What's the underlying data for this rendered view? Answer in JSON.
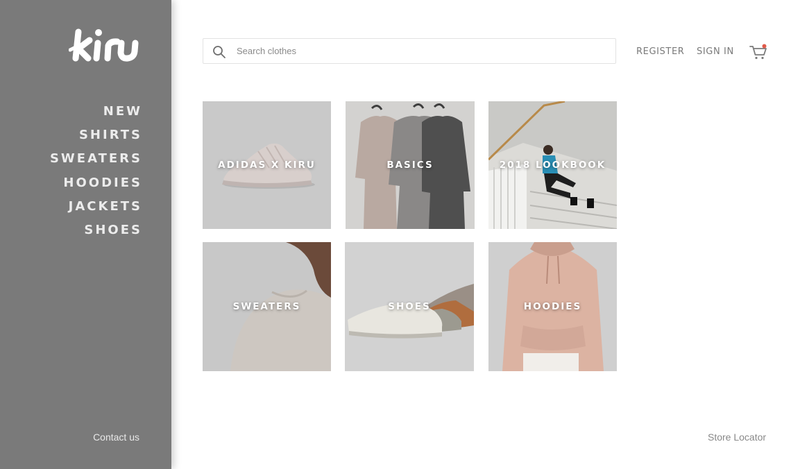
{
  "brand": {
    "logo_text": "kiru"
  },
  "sidebar": {
    "nav": [
      {
        "label": "NEW"
      },
      {
        "label": "SHIRTS"
      },
      {
        "label": "SWEATERS"
      },
      {
        "label": "HOODIES"
      },
      {
        "label": "JACKETS"
      },
      {
        "label": "SHOES"
      }
    ],
    "contact_label": "Contact us"
  },
  "header": {
    "search": {
      "placeholder": "Search clothes",
      "value": ""
    },
    "register_label": "REGISTER",
    "signin_label": "SIGN IN",
    "cart_icon": "cart-icon",
    "cart_badge_color": "#e05a4a"
  },
  "tiles": [
    {
      "label": "ADIDAS X KIRU"
    },
    {
      "label": "BASICS"
    },
    {
      "label": "2018 LOOKBOOK"
    },
    {
      "label": "SWEATERS"
    },
    {
      "label": "SHOES"
    },
    {
      "label": "HOODIES"
    }
  ],
  "footer": {
    "store_locator_label": "Store Locator"
  },
  "colors": {
    "sidebar": "#7a7a7a",
    "nav_text": "#ececec",
    "header_link": "#7a7a7a"
  }
}
